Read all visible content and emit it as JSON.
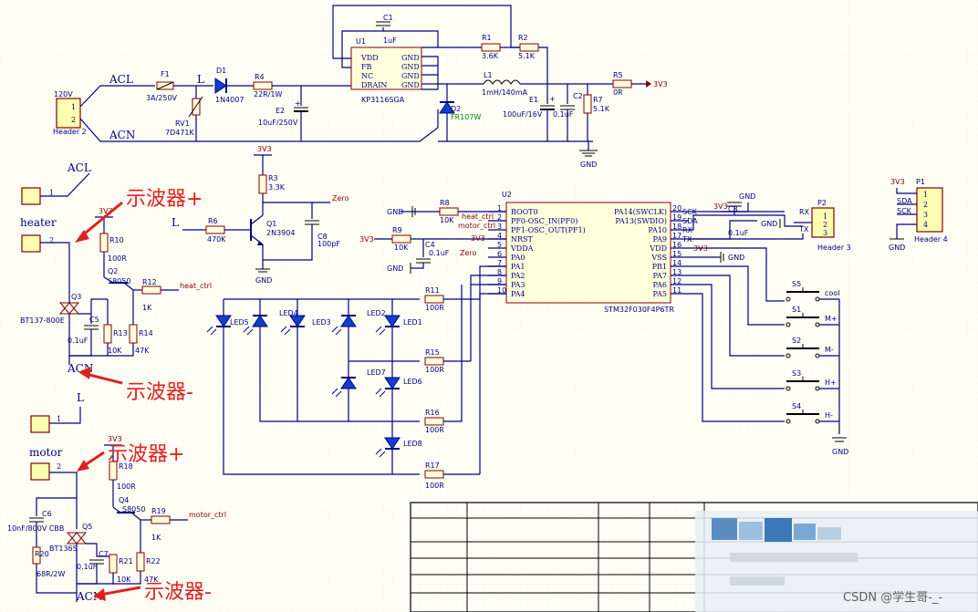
{
  "annotations": {
    "scope_plus_1": "示波器+",
    "scope_minus_1": "示波器-",
    "scope_plus_2": "示波器+",
    "scope_minus_2": "示波器-",
    "watermark": "CSDN @学生哥-_-"
  },
  "nets": {
    "acl_top": "ACL",
    "acn_top": "ACN",
    "l_top": "L",
    "v120": "120V",
    "acl_left": "ACL",
    "heater": "heater",
    "acn_mid": "ACN",
    "l_mid": "L",
    "motor": "motor",
    "acn_bottom": "ACN",
    "l_q1": "L",
    "zero": "Zero",
    "heat_ctrl": "heat_ctrl",
    "motor_ctrl": "motor_ctrl",
    "heat_ctrl_in": "heat_ctrl",
    "motor_ctrl_in": "motor_ctrl",
    "zero_in": "Zero",
    "v3v3_r5": "3V3",
    "v3v3_r3": "3V3",
    "v3v3_r10": "3V3",
    "v3v3_r18": "3V3",
    "v3v3_r9": "3V3",
    "v3v3_u2": "3V3",
    "v3v3_c3": "3V3",
    "v3v3_u2_pin": "3V3",
    "v3v3_p1": "3V3",
    "v3v3_mcu": "3V3",
    "gnd_main": "GND",
    "gnd_q1": "GND",
    "gnd_r8": "GND",
    "gnd_c4": "GND",
    "gnd_c3": "GND",
    "gnd_p2": "GND",
    "gnd_vss": "GND",
    "gnd_sw": "GND",
    "gnd_p1": "GND",
    "rx": "RX",
    "tx": "TX",
    "sda": "SDA",
    "sck": "SCK"
  },
  "components": {
    "f1": {
      "ref": "F1",
      "value": "3A/250V"
    },
    "rv1": {
      "ref": "RV1",
      "value": "7D471K"
    },
    "d1": {
      "ref": "D1",
      "value": "1N4007"
    },
    "r4": {
      "ref": "R4",
      "value": "22R/1W"
    },
    "e2": {
      "ref": "E2",
      "value": "10uF/250V"
    },
    "u1": {
      "ref": "U1",
      "value": "KP3116SGA",
      "pins": [
        "VDD",
        "FB",
        "NC",
        "DRAIN",
        "GND",
        "GND",
        "GND",
        "GND"
      ]
    },
    "c1": {
      "ref": "C1",
      "value": "1uF"
    },
    "r1": {
      "ref": "R1",
      "value": "3.6K"
    },
    "r2": {
      "ref": "R2",
      "value": "5.1K"
    },
    "l1": {
      "ref": "L1",
      "value": "1mH/140mA"
    },
    "d2": {
      "ref": "D2",
      "value": "FR107W"
    },
    "e1": {
      "ref": "E1",
      "value": "100uF/16V"
    },
    "c2": {
      "ref": "C2",
      "value": "0.1uF"
    },
    "r7": {
      "ref": "R7",
      "value": "5.1K"
    },
    "r5": {
      "ref": "R5",
      "value": "0R"
    },
    "r3": {
      "ref": "R3",
      "value": "3.3K"
    },
    "r6": {
      "ref": "R6",
      "value": "470K"
    },
    "q1": {
      "ref": "Q1",
      "value": "2N3904"
    },
    "c8": {
      "ref": "C8",
      "value": "100pF"
    },
    "r10": {
      "ref": "R10",
      "value": "100R"
    },
    "q2": {
      "ref": "Q2",
      "value": "S8050"
    },
    "r12": {
      "ref": "R12",
      "value": "1K"
    },
    "q3": {
      "ref": "Q3",
      "value": "BT137-800E"
    },
    "c5": {
      "ref": "C5",
      "value": "0.1uF"
    },
    "r13": {
      "ref": "R13",
      "value": "10K"
    },
    "r14": {
      "ref": "R14",
      "value": "47K"
    },
    "r18": {
      "ref": "R18",
      "value": "100R"
    },
    "q4": {
      "ref": "Q4",
      "value": "S8050"
    },
    "r19": {
      "ref": "R19",
      "value": "1K"
    },
    "c6": {
      "ref": "C6",
      "value": "10nF/800V CBB"
    },
    "q5": {
      "ref": "Q5",
      "value": "BT136S"
    },
    "r20": {
      "ref": "R20",
      "value": "68R/2W"
    },
    "c7": {
      "ref": "C7",
      "value": "0.1uF"
    },
    "r21": {
      "ref": "R21",
      "value": "10K"
    },
    "r22": {
      "ref": "R22",
      "value": "47K"
    },
    "r8": {
      "ref": "R8",
      "value": "10K"
    },
    "r9": {
      "ref": "R9",
      "value": "10K"
    },
    "c4": {
      "ref": "C4",
      "value": "0.1uF"
    },
    "c3": {
      "ref": "C3",
      "value": "0.1uF"
    },
    "r11": {
      "ref": "R11",
      "value": "100R"
    },
    "r15": {
      "ref": "R15",
      "value": "100R"
    },
    "r16": {
      "ref": "R16",
      "value": "100R"
    },
    "r17": {
      "ref": "R17",
      "value": "100R"
    },
    "leds": [
      "LED5",
      "LED4",
      "LED3",
      "LED2",
      "LED1",
      "LED7",
      "LED6",
      "LED8"
    ],
    "u2": {
      "ref": "U2",
      "value": "STM32F030F4P6TR",
      "left_pins": [
        {
          "name": "BOOT0",
          "num": "1"
        },
        {
          "name": "PF0-OSC_IN(PF0)",
          "num": "2"
        },
        {
          "name": "PF1-OSC_OUT(PF1)",
          "num": "3"
        },
        {
          "name": "NRST",
          "num": "4"
        },
        {
          "name": "VDDA",
          "num": "5"
        },
        {
          "name": "PA0",
          "num": "6"
        },
        {
          "name": "PA1",
          "num": "7"
        },
        {
          "name": "PA2",
          "num": "8"
        },
        {
          "name": "PA3",
          "num": "9"
        },
        {
          "name": "PA4",
          "num": "10"
        }
      ],
      "right_pins": [
        {
          "name": "PA14(SWCLK)",
          "num": "20",
          "net": "SCK"
        },
        {
          "name": "PA13(SWDIO)",
          "num": "19",
          "net": "SDA"
        },
        {
          "name": "PA10",
          "num": "18",
          "net": "RX"
        },
        {
          "name": "PA9",
          "num": "17",
          "net": "TX"
        },
        {
          "name": "VDD",
          "num": "16",
          "net": ""
        },
        {
          "name": "VSS",
          "num": "15",
          "net": ""
        },
        {
          "name": "PB1",
          "num": "14",
          "net": ""
        },
        {
          "name": "PA7",
          "num": "13",
          "net": ""
        },
        {
          "name": "PA6",
          "num": "12",
          "net": ""
        },
        {
          "name": "PA5",
          "num": "11",
          "net": ""
        }
      ]
    },
    "switches": [
      {
        "ref": "S5",
        "label": "cool"
      },
      {
        "ref": "S1",
        "label": "M+"
      },
      {
        "ref": "S2",
        "label": "M-"
      },
      {
        "ref": "S3",
        "label": "H+"
      },
      {
        "ref": "S4",
        "label": "H-"
      }
    ],
    "headers": {
      "h2": {
        "name": "Header 2",
        "pins": [
          "1",
          "2"
        ]
      },
      "p2": {
        "ref": "P2",
        "name": "Header 3",
        "pins": [
          "1",
          "2",
          "3"
        ]
      },
      "p1": {
        "ref": "P1",
        "name": "Header 4",
        "pins": [
          "1",
          "2",
          "3",
          "4"
        ]
      },
      "j_acl": {
        "pin": "1"
      },
      "j_heater": {
        "pin": "2"
      },
      "j_l": {
        "pin": "1"
      },
      "j_motor": {
        "pin": "2"
      }
    }
  },
  "colors": {
    "wire": "#000080",
    "component": "#800000",
    "annotation": "#e02020",
    "led": "#1040d0",
    "background": "#fffff6"
  }
}
